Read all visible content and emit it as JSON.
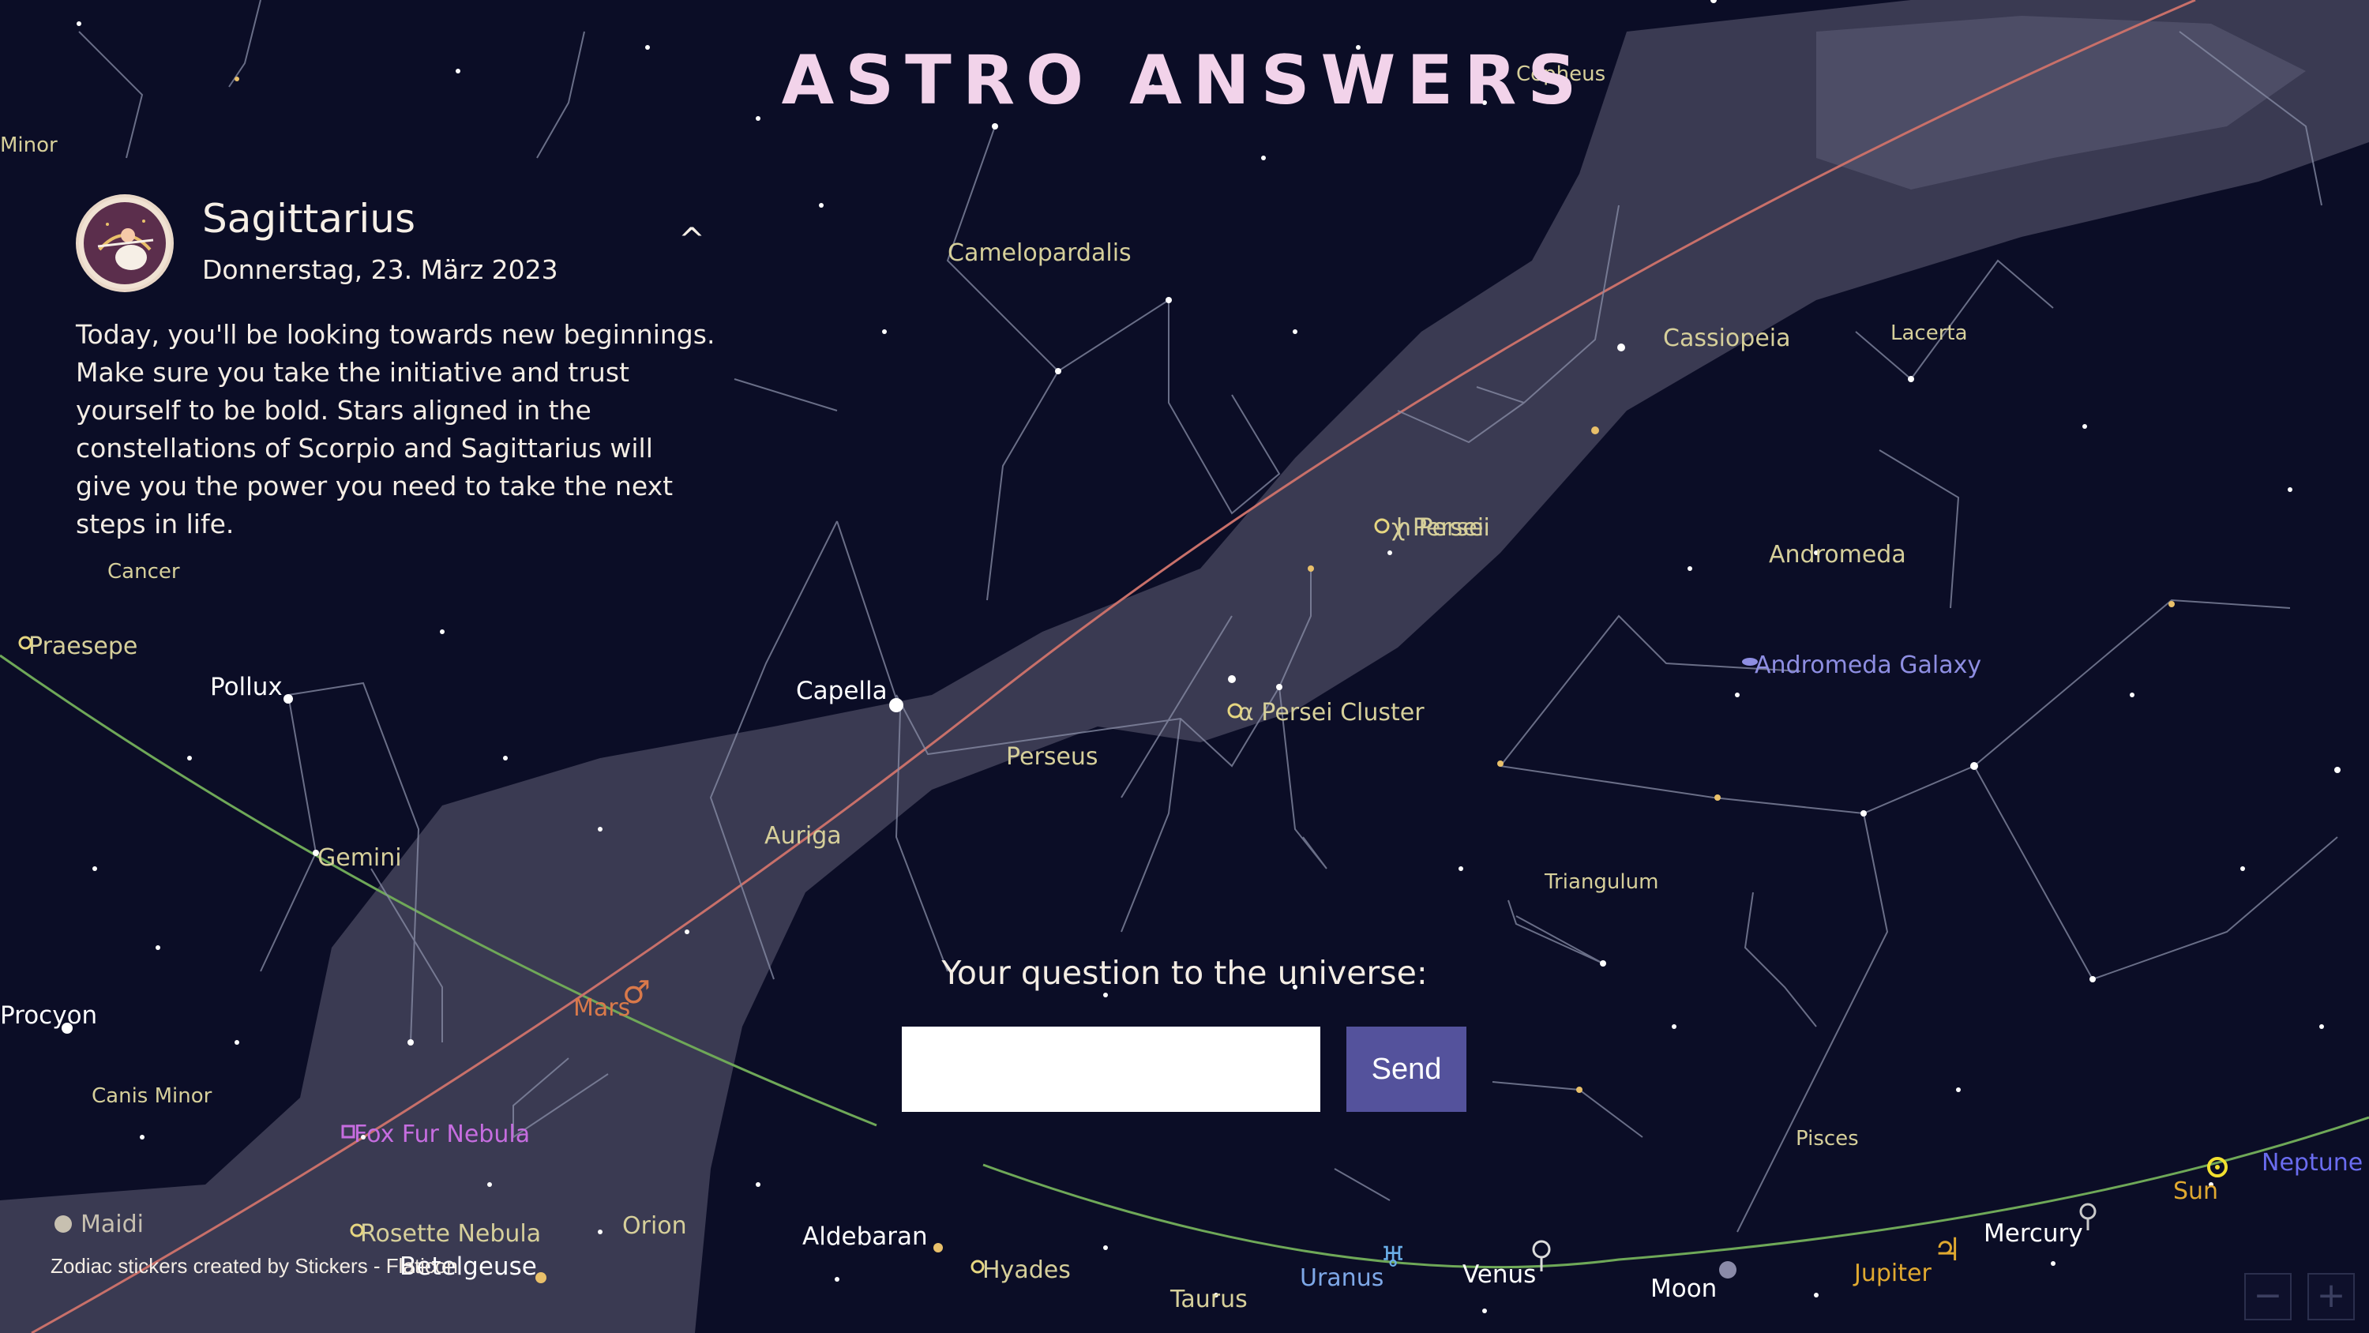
{
  "app": {
    "title": "ASTRO ANSWERS"
  },
  "horoscope": {
    "sign": "Sagittarius",
    "date": "Donnerstag, 23. März 2023",
    "collapse_glyph": "^",
    "text": "Today, you'll be looking towards new beginnings. Make sure you take the initiative and trust yourself to be bold. Stars aligned in the constellations of Scorpio and Sagittarius will give you the power you need to take the next steps in life."
  },
  "question": {
    "label": "Your question to the universe:",
    "input_value": "",
    "send_label": "Send"
  },
  "credit": "Zodiac stickers created by Stickers - Flaticon",
  "zoom": {
    "out_label": "−",
    "in_label": "+"
  },
  "sky": {
    "constellations": [
      "Minor",
      "Camelopardalis",
      "Cassiopeia",
      "Lacerta",
      "Andromeda",
      "Triangulum",
      "Pisces",
      "Perseus",
      "Auriga",
      "Gemini",
      "Canis Minor",
      "Orion",
      "Taurus",
      "Cancer",
      "Cepheus",
      "Procyon"
    ],
    "stars": [
      "Capella",
      "Pollux",
      "Aldebaran",
      "Betelgeuse"
    ],
    "deep_sky": [
      "Praesepe",
      "χ Persei",
      "h Persei",
      "α Persei Cluster",
      "Andromeda Galaxy",
      "Fox Fur Nebula",
      "Rosette Nebula",
      "Hyades",
      "Maidi"
    ],
    "planets": [
      "Mars",
      "Uranus",
      "Venus",
      "Moon",
      "Jupiter",
      "Mercury",
      "Sun",
      "Neptune"
    ]
  },
  "colors": {
    "background": "#0b0d26",
    "milky_way": "#3a3a52",
    "title": "#f2d3ea",
    "send_button": "#54529c",
    "ecliptic": "#6fa858",
    "equator": "#c8706a"
  }
}
